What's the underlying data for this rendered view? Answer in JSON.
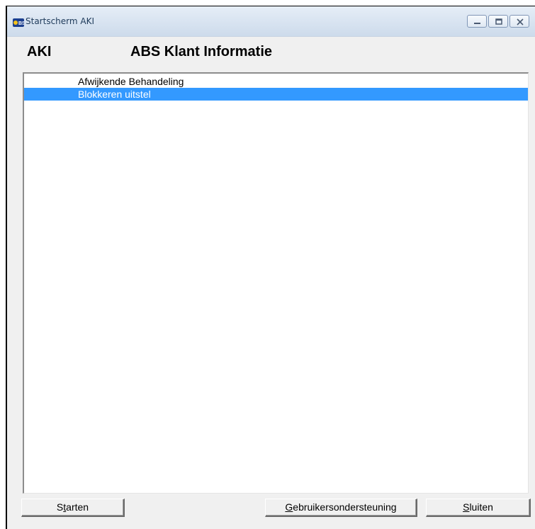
{
  "window": {
    "title": "Startscherm AKI",
    "icon": "abs-logo-icon"
  },
  "header": {
    "code": "AKI",
    "title": "ABS Klant Informatie"
  },
  "list": {
    "items": [
      {
        "label": "Afwijkende Behandeling",
        "selected": false
      },
      {
        "label": "Blokkeren uitstel",
        "selected": true
      }
    ]
  },
  "buttons": {
    "start": {
      "before": "S",
      "mnemonic": "t",
      "after": "arten"
    },
    "help": {
      "before": "",
      "mnemonic": "G",
      "after": "ebruikersondersteuning"
    },
    "close": {
      "before": "",
      "mnemonic": "S",
      "after": "luiten"
    }
  },
  "colors": {
    "selection": "#3399ff",
    "titlebar": "#d9e4f1"
  }
}
